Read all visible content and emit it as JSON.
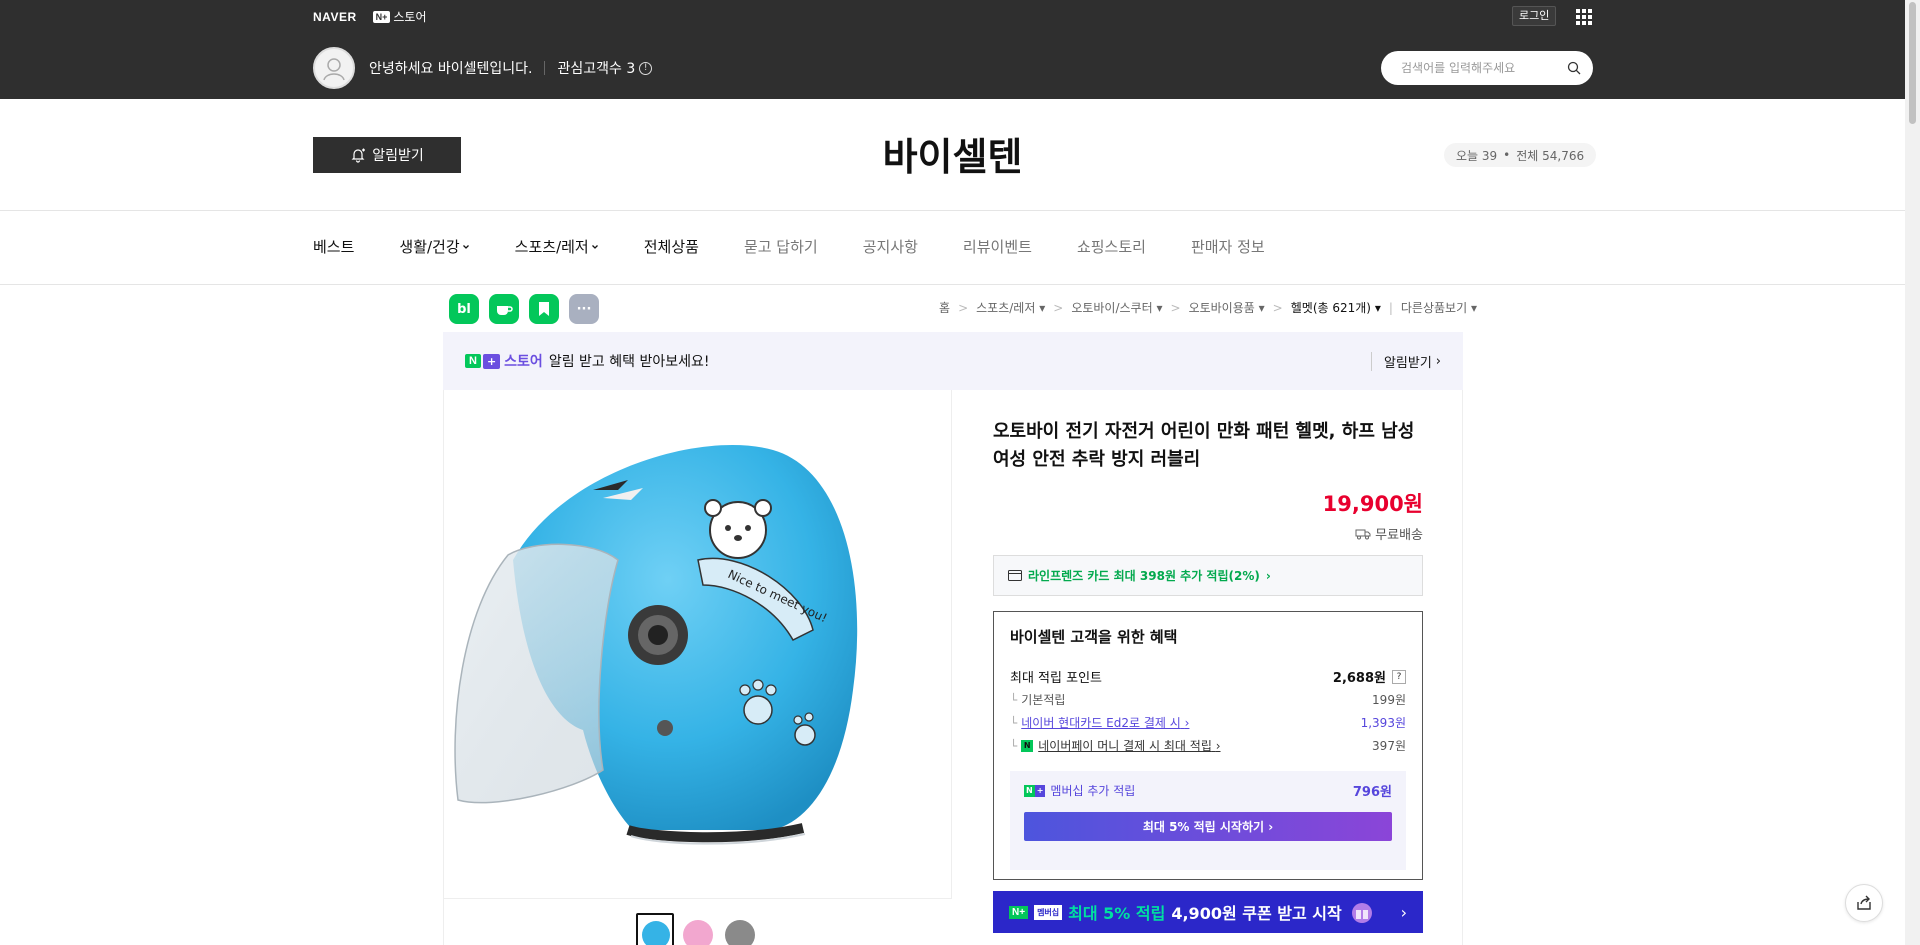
{
  "gnb": {
    "naver_logo": "NAVER",
    "nplus_mark": "N+",
    "store_label": "스토어",
    "login_label": "로그인",
    "greeting": "안녕하세요 바이셀텐입니다.",
    "fav_label": "관심고객수 3",
    "info_glyph": "!",
    "search_placeholder": "검색어를 입력해주세요"
  },
  "store": {
    "alarm_label": "알림받기",
    "title": "바이셀텐",
    "today_label": "오늘 39",
    "total_label": "전체 54,766",
    "dot": "•"
  },
  "nav": {
    "items": [
      {
        "label": "베스트"
      },
      {
        "label": "생활/건강"
      },
      {
        "label": "스포츠/레저"
      },
      {
        "label": "전체상품"
      },
      {
        "label": "묻고 답하기"
      },
      {
        "label": "공지사항"
      },
      {
        "label": "리뷰이벤트"
      },
      {
        "label": "쇼핑스토리"
      },
      {
        "label": "판매자 정보"
      }
    ]
  },
  "sns": {
    "blog": "bl",
    "more": "···"
  },
  "breadcrumb": {
    "home": "홈",
    "c1": "스포츠/레저",
    "c2": "오토바이/스쿠터",
    "c3": "오토바이용품",
    "c4": "헬멧(총 621개)",
    "other": "다른상품보기",
    "sep": ">",
    "caret": "▾"
  },
  "banner": {
    "n_logo": "N",
    "plus": "+",
    "store_text": "스토어",
    "message": "알림 받고 혜택 받아보세요!",
    "action": "알림받기",
    "chevron": "›"
  },
  "product": {
    "title": "오토바이 전기 자전거 어린이 만화 패턴 헬멧, 하프 남성 여성 안전 추락 방지 러블리",
    "price": "19,900원",
    "shipping": "무료배송",
    "helmet_text": "Nice to meet you!"
  },
  "card_benefit": {
    "text": "라인프렌즈 카드 최대 398원 추가 적립(2%)",
    "chevron": "›"
  },
  "benefit": {
    "heading": "바이셀텐 고객을 위한 혜택",
    "max_points_label": "최대 적립 포인트",
    "max_points_value": "2,688원",
    "help": "?",
    "tree": "└",
    "basic_label": "기본적립",
    "basic_value": "199원",
    "hyundai_label": "네이버 현대카드 Ed2로 결제 시",
    "hyundai_value": "1,393원",
    "npay_mark": "N",
    "npay_label": "네이버페이 머니 결제 시 최대 적립",
    "npay_value": "397원",
    "chevron": "›",
    "membership_n": "N",
    "membership_plus": "+",
    "membership_label": "멤버십 추가 적립",
    "membership_value": "796원",
    "start_label": "최대 5% 적립 시작하기"
  },
  "promo": {
    "n": "N+",
    "badge": "멤버십",
    "highlight": "최대 5% 적립",
    "text": "4,900원 쿠폰 받고 시작",
    "chevron": "›"
  },
  "colors": {
    "header_bg": "#2f2f2f",
    "naver_green": "#03c75a",
    "price_red": "#e8002e",
    "membership_purple": "#5646dc",
    "promo_blue": "#2b27c9",
    "helmet_blue": "#35b3e6"
  },
  "icons": [
    "avatar-icon",
    "info-icon",
    "search-icon",
    "apps-grid-icon",
    "bell-icon",
    "truck-icon",
    "card-icon",
    "share-icon"
  ]
}
